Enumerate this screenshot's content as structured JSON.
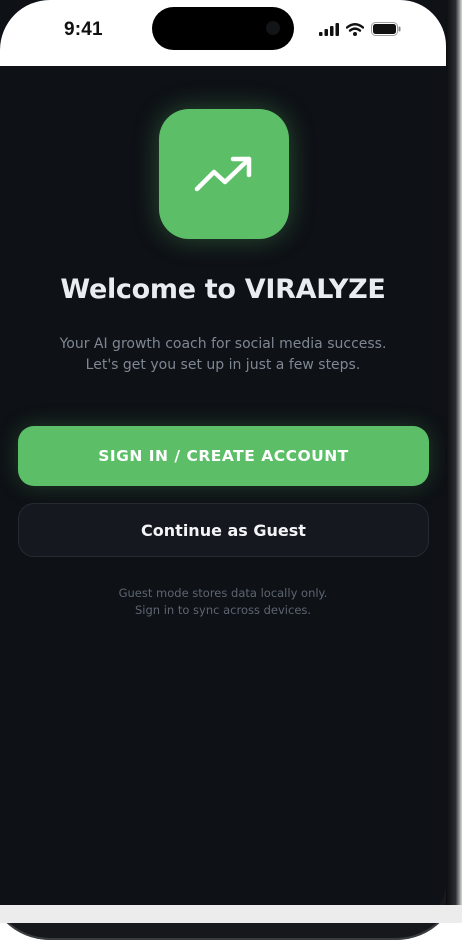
{
  "status_bar": {
    "time": "9:41",
    "icons": [
      "signal-icon",
      "wifi-icon",
      "battery-icon"
    ]
  },
  "logo": {
    "icon": "trending-up-icon",
    "color": "#5cbf68"
  },
  "welcome": {
    "title": "Welcome to VIRALYZE",
    "subtitle_line1": "Your AI growth coach for social media success.",
    "subtitle_line2": "Let's get you set up in just a few steps."
  },
  "actions": {
    "primary_label": "SIGN IN / CREATE ACCOUNT",
    "secondary_label": "Continue as Guest"
  },
  "note": {
    "line1": "Guest mode stores data locally only.",
    "line2": "Sign in to sync across devices."
  },
  "colors": {
    "accent": "#5cbf68",
    "background": "#0e1116",
    "secondary_button": "#15181e"
  }
}
